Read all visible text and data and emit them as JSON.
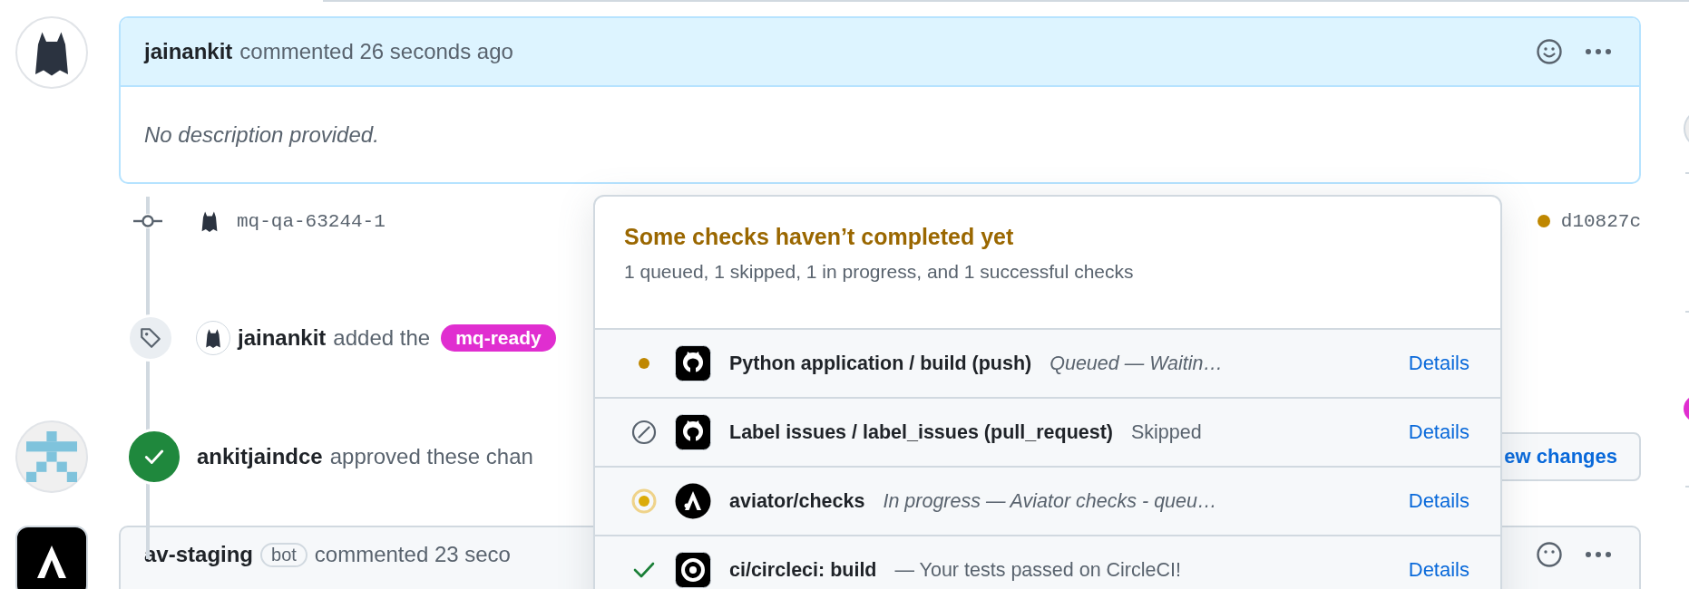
{
  "comment": {
    "author": "jainankit",
    "action": "commented 26 seconds ago",
    "body": "No description provided."
  },
  "commit": {
    "message": "mq-qa-63244-1",
    "sha": "d10827c",
    "status_dot": {
      "color": "#bf8700"
    }
  },
  "label_event": {
    "actor": "jainankit",
    "action": "added the",
    "label": "mq-ready"
  },
  "review": {
    "actor": "ankitjaindce",
    "action": "approved these chan",
    "button": "ew changes"
  },
  "bot_comment": {
    "author": "av-staging",
    "badge": "bot",
    "action": "commented 23 seco"
  },
  "checks_popup": {
    "title": "Some checks haven’t completed yet",
    "summary": "1 queued, 1 skipped, 1 in progress, and 1 successful checks",
    "checks": [
      {
        "kind": "queued",
        "logo": {
          "kind": "github"
        },
        "name": "Python application / build (push)",
        "description": "Queued — Waitin…",
        "link": "Details"
      },
      {
        "kind": "skipped",
        "logo": {
          "kind": "github"
        },
        "name": "Label issues / label_issues (pull_request)",
        "description": "Skipped",
        "link": "Details"
      },
      {
        "kind": "in_progress",
        "logo": {
          "kind": "aviator"
        },
        "name": "aviator/checks",
        "description": "In progress — Aviator checks - queu…",
        "link": "Details"
      },
      {
        "kind": "success",
        "logo": {
          "kind": "circleci"
        },
        "name": "ci/circleci: build",
        "description": "— Your tests passed on CircleCI!",
        "link": "Details"
      }
    ]
  }
}
